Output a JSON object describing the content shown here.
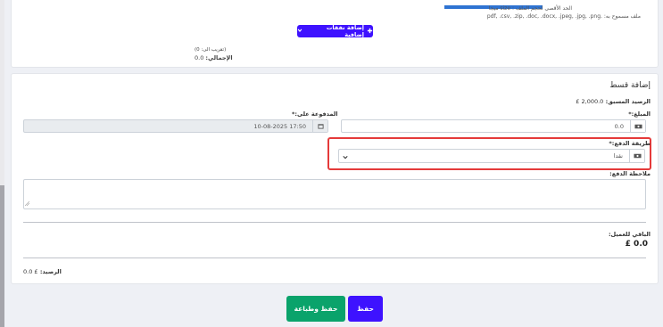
{
  "upload": {
    "max_size_hint": "الحد الأقصى لحجم الملف : size ميجا",
    "allowed_types_label": "ملف مسموح به:",
    "allowed_types": "pdf, .csv, .zip, .doc, .docx, .jpeg, .jpg, .png."
  },
  "expenses": {
    "add_button": "إضافة نفقات إضافية",
    "rounding_note": "(تقريب الى: 0)",
    "total_label": "الإجمالي:",
    "total_value": "0.0"
  },
  "installment": {
    "title": "إضافة قسط",
    "prev_balance_label": "الرصيد المسبق:",
    "prev_balance_value": "2,000.0 £",
    "amount_label": "المبلغ:*",
    "amount_value": "0.0",
    "paid_on_label": "المدفوعة على:*",
    "paid_on_value": "10-08-2025 17:50",
    "payment_method_label": "طريقة الدفع:*",
    "payment_method_value": "نقدا",
    "payment_note_label": "ملاحظة الدفع:",
    "remaining_label": "الباقي للعميل:",
    "remaining_value": "£ 0.0",
    "balance_label": "الرصيد:",
    "balance_value": "£ 0.0"
  },
  "actions": {
    "save_print": "حفظ وطباعة",
    "save": "حفظ"
  },
  "colors": {
    "primary": "#3e12ff",
    "success": "#0aa36b",
    "highlight": "#e53a3a"
  },
  "icons": [
    "plus-icon",
    "cash-icon",
    "calendar-icon",
    "chevron-down-icon"
  ]
}
